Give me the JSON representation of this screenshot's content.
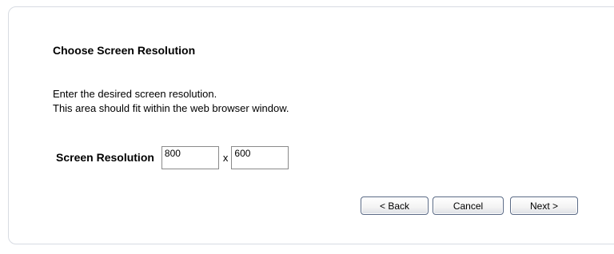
{
  "dialog": {
    "title": "Choose Screen Resolution",
    "description_line1": "Enter the desired screen resolution.",
    "description_line2": "This area should fit within the web browser window."
  },
  "resolution": {
    "label": "Screen Resolution",
    "width": "800",
    "separator": "x",
    "height": "600"
  },
  "buttons": {
    "back": "< Back",
    "cancel": "Cancel",
    "next": "Next >"
  }
}
